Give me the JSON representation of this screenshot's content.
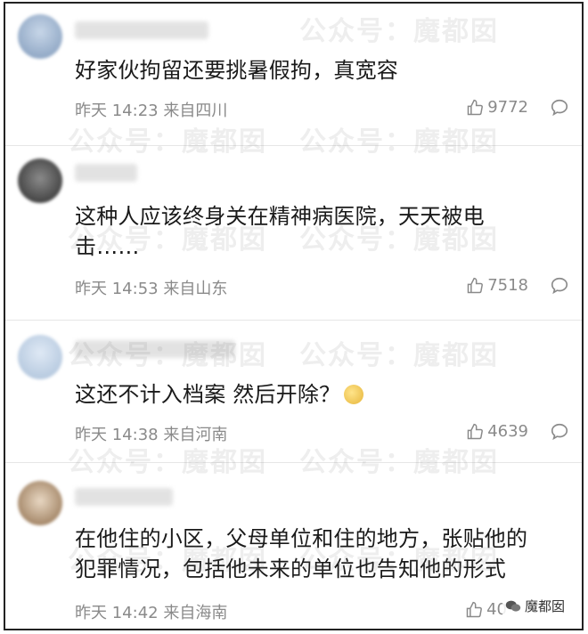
{
  "watermark": "公众号：魔都囡",
  "brand": {
    "label": "魔都囡"
  },
  "comments": [
    {
      "text": "好家伙拘留还要挑暑假拘，真宽容",
      "time": "昨天 14:23",
      "location": "来自四川",
      "likes": "9772",
      "avatar_color": "#9fb4d0"
    },
    {
      "text": "这种人应该终身关在精神病医院，天天被电击……",
      "time": "昨天 14:53",
      "location": "来自山东",
      "likes": "7518",
      "avatar_color": "#4a4a4a"
    },
    {
      "text": "这还不计入档案 然后开除？",
      "time": "昨天 14:38",
      "location": "来自河南",
      "likes": "4639",
      "avatar_color": "#b9cde3",
      "has_emoji": true
    },
    {
      "text": "在他住的小区，父母单位和住的地方，张贴他的犯罪情况，包括他未来的单位也告知他的形式",
      "time": "昨天 14:42",
      "location": "来自海南",
      "likes": "40",
      "avatar_color": "#b89a7a"
    }
  ]
}
